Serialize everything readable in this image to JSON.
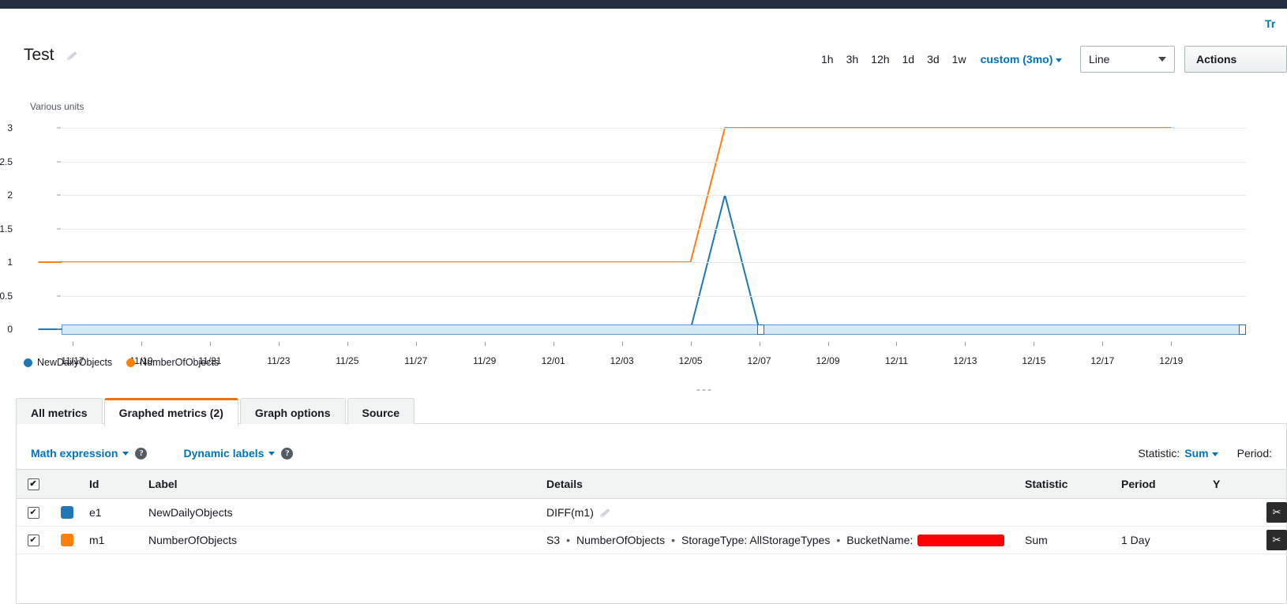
{
  "top": {
    "try_link": "Tr"
  },
  "header": {
    "title": "Test",
    "edit_icon": "pencil-icon",
    "ranges": [
      "1h",
      "3h",
      "12h",
      "1d",
      "3d",
      "1w"
    ],
    "custom_range": "custom (3mo)",
    "graph_type": "Line",
    "actions_label": "Actions"
  },
  "chart_data": {
    "type": "line",
    "title": "Test",
    "ylabel": "Various units",
    "xlabel": "",
    "ylim": [
      0,
      3
    ],
    "yticks": [
      "0",
      "0.5",
      "1",
      "1.5",
      "2",
      "2.5",
      "3"
    ],
    "grid": true,
    "legend_position": "bottom-left",
    "xticks": [
      "11/17",
      "11/19",
      "11/21",
      "11/23",
      "11/25",
      "11/27",
      "11/29",
      "12/01",
      "12/03",
      "12/05",
      "12/07",
      "12/09",
      "12/11",
      "12/13",
      "12/15",
      "12/17",
      "12/19"
    ],
    "series": [
      {
        "name": "NewDailyObjects",
        "color": "#1f77b4",
        "x": [
          "11/16",
          "11/17",
          "11/19",
          "11/21",
          "11/23",
          "11/25",
          "11/27",
          "11/29",
          "12/01",
          "12/03",
          "12/05",
          "12/06",
          "12/07",
          "12/09",
          "12/11",
          "12/13",
          "12/15",
          "12/17",
          "12/19",
          "12/20"
        ],
        "values": [
          0,
          0,
          0,
          0,
          0,
          0,
          0,
          0,
          0,
          0,
          0,
          2,
          0,
          0,
          0,
          0,
          0,
          0,
          0,
          0
        ]
      },
      {
        "name": "NumberOfObjects",
        "color": "#ff7f0e",
        "x": [
          "11/16",
          "11/17",
          "11/19",
          "11/21",
          "11/23",
          "11/25",
          "11/27",
          "11/29",
          "12/01",
          "12/03",
          "12/05",
          "12/06",
          "12/07",
          "12/09",
          "12/11",
          "12/13",
          "12/15",
          "12/17",
          "12/19"
        ],
        "values": [
          1,
          1,
          1,
          1,
          1,
          1,
          1,
          1,
          1,
          1,
          1,
          3,
          3,
          3,
          3,
          3,
          3,
          3,
          3
        ]
      }
    ]
  },
  "resize_handle": "---",
  "tabs": [
    {
      "label": "All metrics",
      "active": false
    },
    {
      "label": "Graphed metrics (2)",
      "active": true
    },
    {
      "label": "Graph options",
      "active": false
    },
    {
      "label": "Source",
      "active": false
    }
  ],
  "panel_toolbar": {
    "math_expression": "Math expression",
    "dynamic_labels": "Dynamic labels",
    "help_glyph": "?",
    "statistic_label": "Statistic:",
    "statistic_value": "Sum",
    "period_label": "Period:"
  },
  "table": {
    "columns": [
      "Id",
      "Label",
      "Details",
      "Statistic",
      "Period",
      "Y"
    ],
    "rows": [
      {
        "checked": true,
        "color": "#1f77b4",
        "id": "e1",
        "label": "NewDailyObjects",
        "details_text": "DIFF(m1)",
        "details_type": "expression",
        "edit_icon": "pencil-icon",
        "statistic": "",
        "period": "",
        "action_glyph": "✂"
      },
      {
        "checked": true,
        "color": "#ff7f0e",
        "id": "m1",
        "label": "NumberOfObjects",
        "details_type": "metric",
        "details_parts": [
          "S3",
          "NumberOfObjects",
          "StorageType: AllStorageTypes",
          "BucketName:"
        ],
        "details_redacted": true,
        "statistic": "Sum",
        "period": "1 Day",
        "action_glyph": "✂"
      }
    ]
  }
}
